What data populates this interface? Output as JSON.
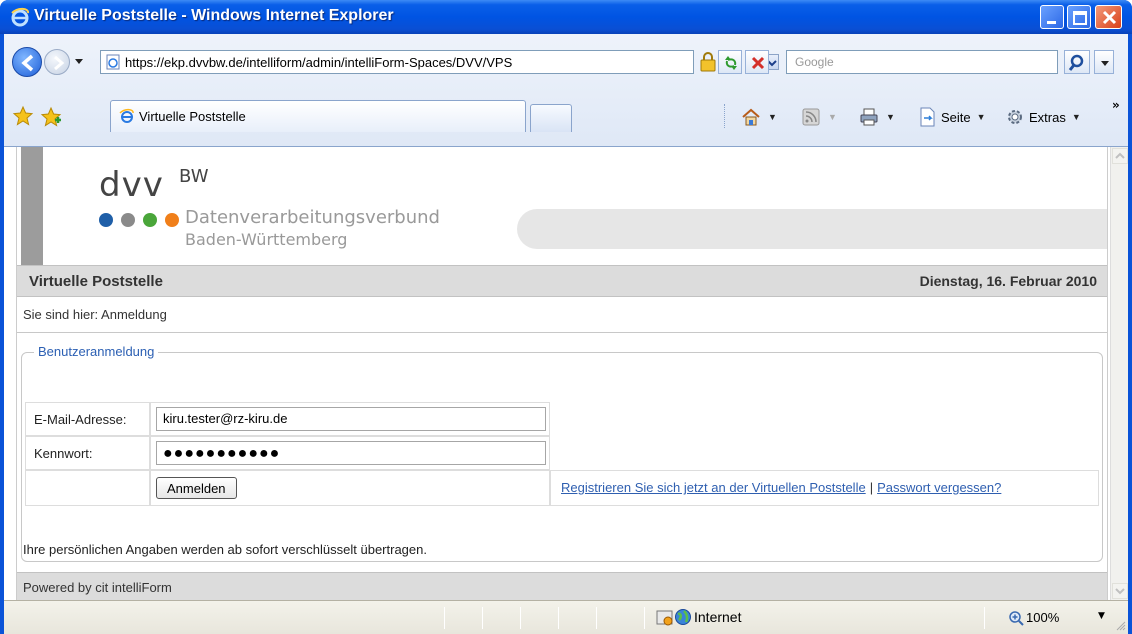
{
  "window": {
    "title": "Virtuelle Poststelle - Windows Internet Explorer"
  },
  "toolbar": {
    "address": "https://ekp.dvvbw.de/intelliform/admin/intelliForm-Spaces/DVV/VPS",
    "search_placeholder": "Google",
    "tab_label": "Virtuelle Poststelle",
    "page_menu": "Seite",
    "tools_menu": "Extras"
  },
  "header": {
    "logo_word": "dvv",
    "logo_sup": "BW",
    "logo_line1": "Datenverarbeitungsverbund",
    "logo_line2": "Baden-Württemberg",
    "dot_colors": [
      "#1f5fa8",
      "#8a8a8a",
      "#4aa63a",
      "#f07f1a"
    ]
  },
  "section": {
    "title": "Virtuelle Poststelle",
    "date": "Dienstag, 16. Februar 2010"
  },
  "breadcrumb": "Sie sind hier: Anmeldung",
  "login": {
    "legend": "Benutzeranmeldung",
    "email_label": "E-Mail-Adresse:",
    "email_value": "kiru.tester@rz-kiru.de",
    "password_label": "Kennwort:",
    "password_value": "●●●●●●●●●●●",
    "submit_label": "Anmelden",
    "register_link": "Registrieren Sie sich jetzt an der Virtuellen Poststelle",
    "separator": "|",
    "forgot_link": "Passwort vergessen?"
  },
  "notice": "Ihre persönlichen Angaben werden ab sofort verschlüsselt übertragen.",
  "footer": "Powered by cit intelliForm",
  "status": {
    "zone": "Internet",
    "zoom": "100%"
  }
}
